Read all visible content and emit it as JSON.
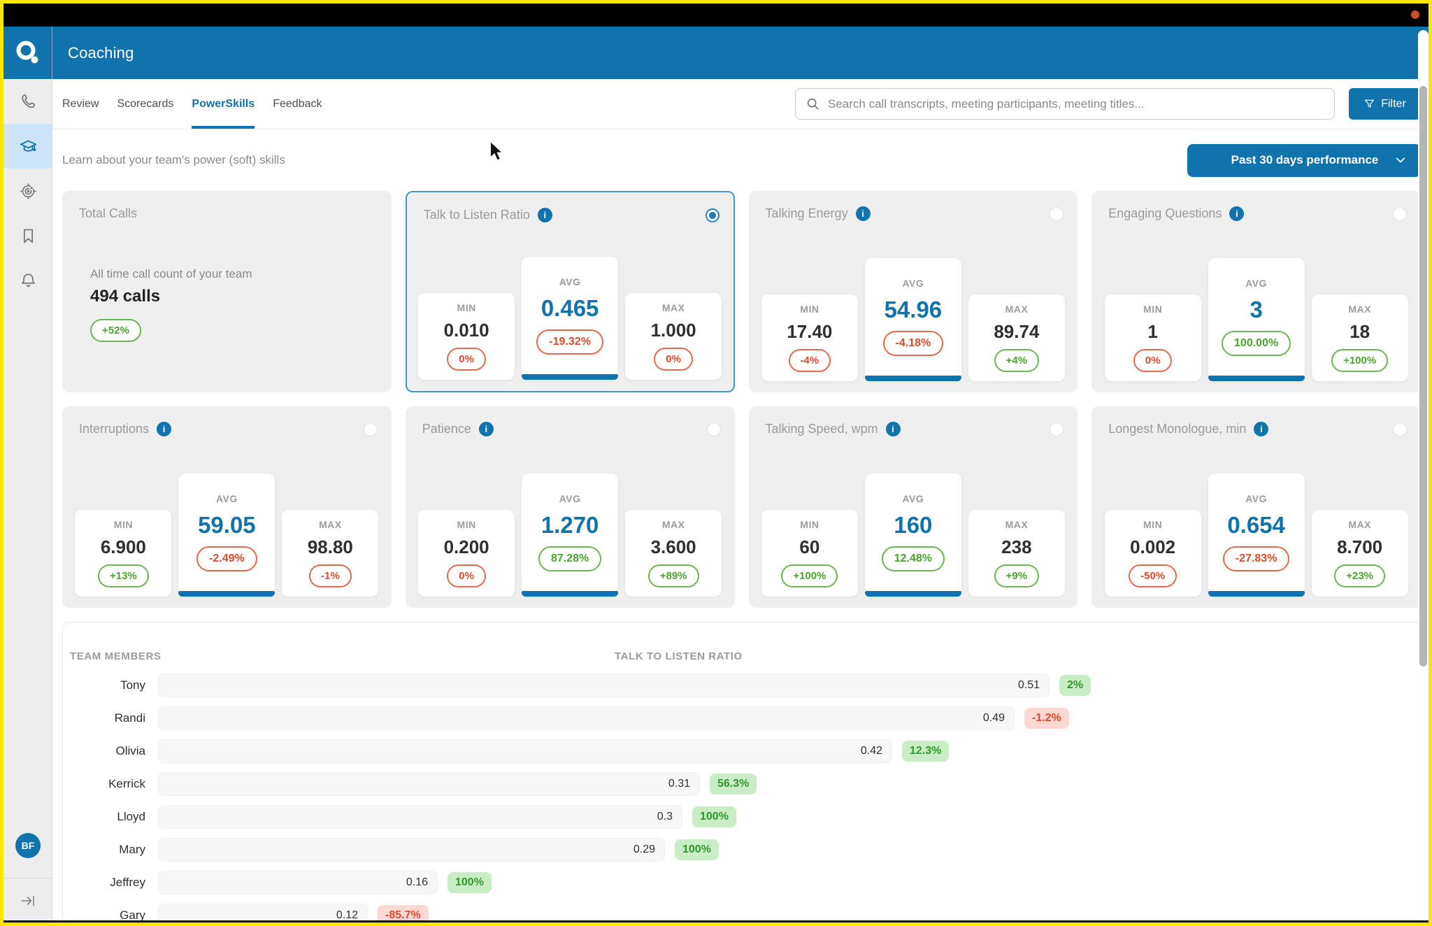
{
  "window": {
    "record_indicator": "record-dot"
  },
  "header": {
    "title": "Coaching",
    "logo": "outreach-logo"
  },
  "sidebar": {
    "items": [
      {
        "icon": "phone-icon",
        "active": false
      },
      {
        "icon": "coaching-cap-icon",
        "active": true
      },
      {
        "icon": "targets-icon",
        "active": false
      },
      {
        "icon": "bookmark-icon",
        "active": false
      },
      {
        "icon": "bell-icon",
        "active": false
      }
    ],
    "avatar_initials": "BF",
    "collapse_icon": "expand-sidebar-icon"
  },
  "tabs": [
    {
      "label": "Review",
      "active": false
    },
    {
      "label": "Scorecards",
      "active": false
    },
    {
      "label": "PowerSkills",
      "active": true
    },
    {
      "label": "Feedback",
      "active": false
    }
  ],
  "search": {
    "placeholder": "Search call transcripts, meeting participants, meeting titles...",
    "value": "",
    "icon": "search-icon"
  },
  "filter_button": {
    "label": "Filter",
    "icon": "funnel-icon"
  },
  "subheader": {
    "description": "Learn about your team's power (soft) skills",
    "period_button": "Past 30 days performance",
    "period_icon": "chevron-down-icon"
  },
  "labels": {
    "min": "MIN",
    "avg": "AVG",
    "max": "MAX"
  },
  "summary_card": {
    "title": "Total Calls",
    "description": "All time call count of your team",
    "value": "494 calls",
    "change": "+52%",
    "trend": "green"
  },
  "metric_cards": [
    {
      "title": "Talk to Listen Ratio",
      "selected": true,
      "min": {
        "value": "0.010",
        "change": "0%",
        "trend": "red"
      },
      "avg": {
        "value": "0.465",
        "change": "-19.32%",
        "trend": "red"
      },
      "max": {
        "value": "1.000",
        "change": "0%",
        "trend": "red"
      }
    },
    {
      "title": "Talking Energy",
      "selected": false,
      "min": {
        "value": "17.40",
        "change": "-4%",
        "trend": "red"
      },
      "avg": {
        "value": "54.96",
        "change": "-4.18%",
        "trend": "red"
      },
      "max": {
        "value": "89.74",
        "change": "+4%",
        "trend": "green"
      }
    },
    {
      "title": "Engaging Questions",
      "selected": false,
      "min": {
        "value": "1",
        "change": "0%",
        "trend": "red"
      },
      "avg": {
        "value": "3",
        "change": "100.00%",
        "trend": "green"
      },
      "max": {
        "value": "18",
        "change": "+100%",
        "trend": "green"
      }
    },
    {
      "title": "Interruptions",
      "selected": false,
      "min": {
        "value": "6.900",
        "change": "+13%",
        "trend": "green"
      },
      "avg": {
        "value": "59.05",
        "change": "-2.49%",
        "trend": "red"
      },
      "max": {
        "value": "98.80",
        "change": "-1%",
        "trend": "red"
      }
    },
    {
      "title": "Patience",
      "selected": false,
      "min": {
        "value": "0.200",
        "change": "0%",
        "trend": "red"
      },
      "avg": {
        "value": "1.270",
        "change": "87.28%",
        "trend": "green"
      },
      "max": {
        "value": "3.600",
        "change": "+89%",
        "trend": "green"
      }
    },
    {
      "title": "Talking Speed, wpm",
      "selected": false,
      "min": {
        "value": "60",
        "change": "+100%",
        "trend": "green"
      },
      "avg": {
        "value": "160",
        "change": "12.48%",
        "trend": "green"
      },
      "max": {
        "value": "238",
        "change": "+9%",
        "trend": "green"
      }
    },
    {
      "title": "Longest Monologue, min",
      "selected": false,
      "min": {
        "value": "0.002",
        "change": "-50%",
        "trend": "red"
      },
      "avg": {
        "value": "0.654",
        "change": "-27.83%",
        "trend": "red"
      },
      "max": {
        "value": "8.700",
        "change": "+23%",
        "trend": "green"
      }
    }
  ],
  "team_table": {
    "col_members": "TEAM MEMBERS",
    "col_metric": "TALK TO LISTEN RATIO",
    "rows": [
      {
        "name": "Tony",
        "value": 0.51,
        "value_label": "0.51",
        "change": "2%",
        "trend": "green"
      },
      {
        "name": "Randi",
        "value": 0.49,
        "value_label": "0.49",
        "change": "-1.2%",
        "trend": "red"
      },
      {
        "name": "Olivia",
        "value": 0.42,
        "value_label": "0.42",
        "change": "12.3%",
        "trend": "green"
      },
      {
        "name": "Kerrick",
        "value": 0.31,
        "value_label": "0.31",
        "change": "56.3%",
        "trend": "green"
      },
      {
        "name": "Lloyd",
        "value": 0.3,
        "value_label": "0.3",
        "change": "100%",
        "trend": "green"
      },
      {
        "name": "Mary",
        "value": 0.29,
        "value_label": "0.29",
        "change": "100%",
        "trend": "green"
      },
      {
        "name": "Jeffrey",
        "value": 0.16,
        "value_label": "0.16",
        "change": "100%",
        "trend": "green"
      },
      {
        "name": "Gary",
        "value": 0.12,
        "value_label": "0.12",
        "change": "-85.7%",
        "trend": "red"
      }
    ]
  },
  "chart_data": {
    "type": "bar",
    "orientation": "horizontal",
    "title": "TALK TO LISTEN RATIO",
    "categories": [
      "Tony",
      "Randi",
      "Olivia",
      "Kerrick",
      "Lloyd",
      "Mary",
      "Jeffrey",
      "Gary"
    ],
    "values": [
      0.51,
      0.49,
      0.42,
      0.31,
      0.3,
      0.29,
      0.16,
      0.12
    ],
    "change_labels": [
      "2%",
      "-1.2%",
      "12.3%",
      "56.3%",
      "100%",
      "100%",
      "100%",
      "-85.7%"
    ],
    "xlim": [
      0,
      0.55
    ],
    "grid": false,
    "legend": false
  },
  "colors": {
    "brand_blue": "#1173ab",
    "selected_border_blue": "#4596cd",
    "positive_green": "#4da332",
    "negative_red": "#e0492f",
    "badge_green_bg": "#c9edc4",
    "badge_red_bg": "#fbd8d1",
    "card_gray": "#efefef",
    "frame_yellow": "#ffe600",
    "record_dot": "#cc4c2b"
  }
}
